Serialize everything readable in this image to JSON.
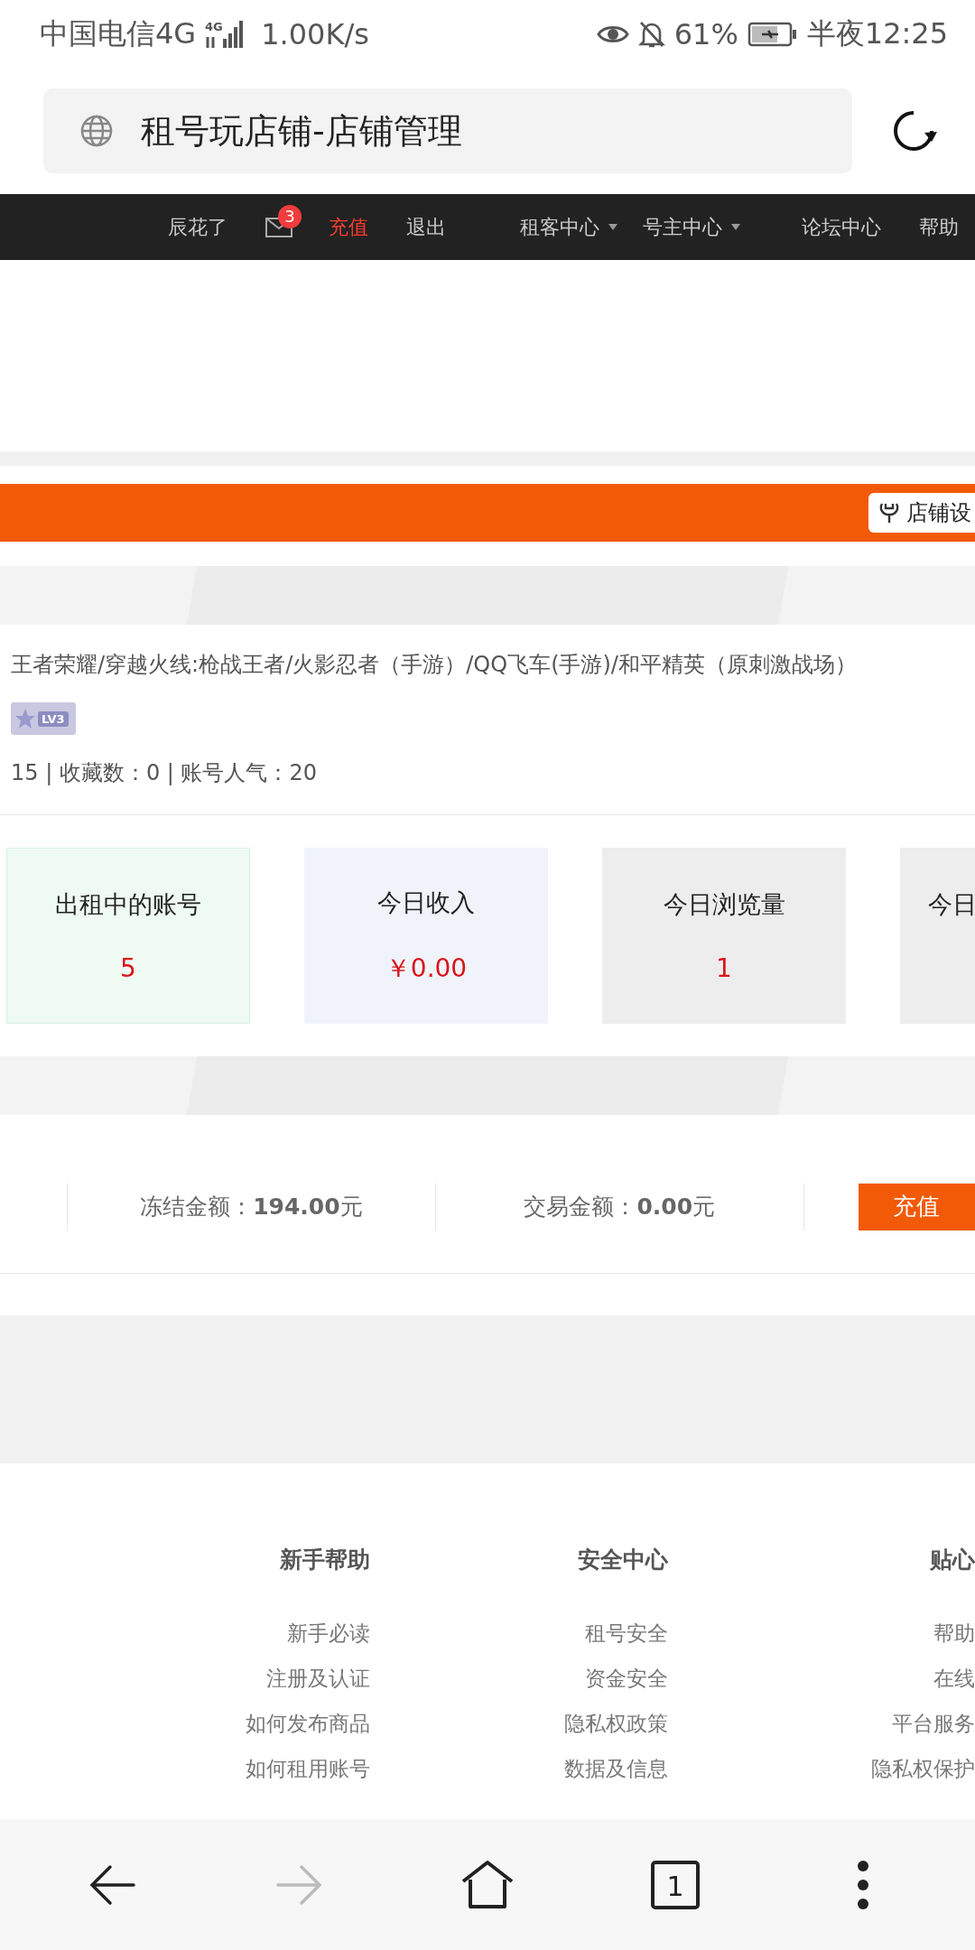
{
  "status_bar": {
    "carrier": "中国电信4G",
    "network": "4G",
    "speed": "1.00K/s",
    "battery": "61%",
    "time": "半夜12:25"
  },
  "address_bar": {
    "title": "租号玩店铺-店铺管理"
  },
  "top_nav": {
    "items": [
      {
        "kind": "text",
        "label": "辰花了"
      },
      {
        "kind": "mail",
        "badge": "3"
      },
      {
        "kind": "accent",
        "label": "充值"
      },
      {
        "kind": "text",
        "label": "退出"
      },
      {
        "kind": "divider"
      },
      {
        "kind": "dropdown",
        "label": "租客中心"
      },
      {
        "kind": "dropdown",
        "label": "号主中心"
      },
      {
        "kind": "divider"
      },
      {
        "kind": "text",
        "label": "论坛中心"
      },
      {
        "kind": "text",
        "label": "帮助"
      }
    ]
  },
  "shop_bar": {
    "settings_button": "店铺设"
  },
  "shop_info": {
    "games": "王者荣耀/穿越火线:枪战王者/火影忍者（手游）/QQ飞车(手游)/和平精英（原刺激战场）",
    "level": "LV3",
    "stats": "15 | 收藏数：0 | 账号人气：20"
  },
  "stat_cards": [
    {
      "label": "出租中的账号",
      "value": "5",
      "color": "#eefaf2"
    },
    {
      "label": "今日收入",
      "value": "￥0.00",
      "color": "#f0f4fa"
    },
    {
      "label": "今日浏览量",
      "value": "1",
      "color": "#ededed"
    },
    {
      "label": "今日",
      "color": "#ededed"
    }
  ],
  "wallet": {
    "items": [
      {
        "label": "冻结金额：",
        "amount": "194.00",
        "unit": "元"
      },
      {
        "label": "交易金额：",
        "amount": "0.00",
        "unit": "元"
      }
    ],
    "button": "充值"
  },
  "footer": {
    "columns": [
      {
        "title": "新手帮助",
        "links": [
          "新手必读",
          "注册及认证",
          "如何发布商品",
          "如何租用账号"
        ]
      },
      {
        "title": "安全中心",
        "links": [
          "租号安全",
          "资金安全",
          "隐私权政策",
          "数据及信息"
        ]
      },
      {
        "title": "贴心",
        "links": [
          "帮助",
          "在线",
          "平台服务",
          "隐私权保护"
        ]
      }
    ]
  },
  "bottom_nav": [
    {
      "kind": "back",
      "disabled": false
    },
    {
      "kind": "forward",
      "disabled": true
    },
    {
      "kind": "home",
      "disabled": false
    },
    {
      "kind": "tabs",
      "label": "1",
      "disabled": false
    },
    {
      "kind": "menu",
      "disabled": false
    }
  ]
}
